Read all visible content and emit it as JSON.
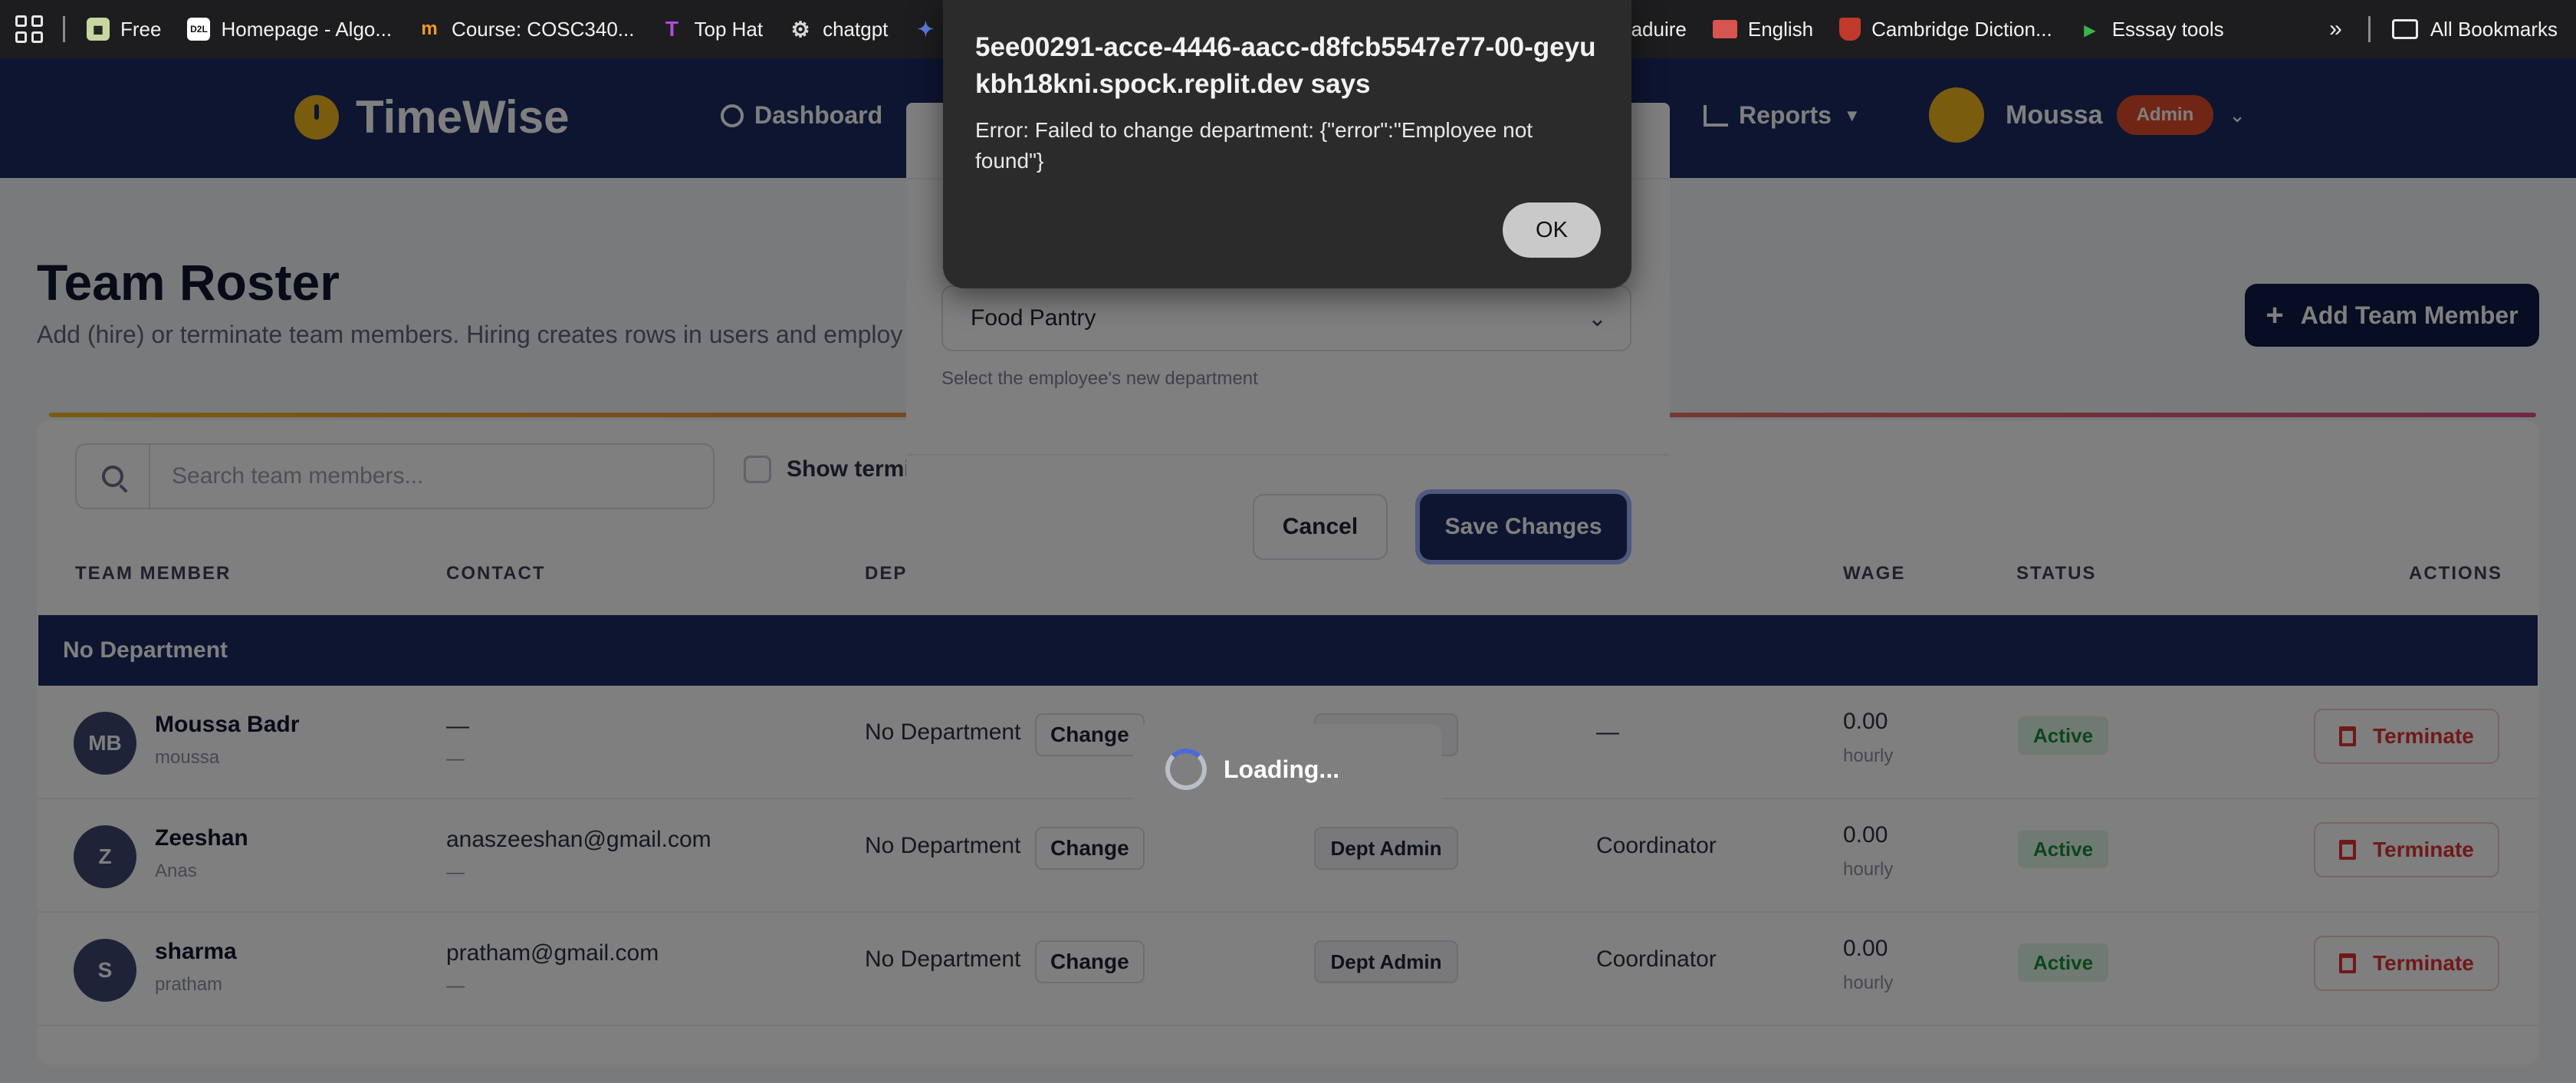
{
  "bookmarks": {
    "items": [
      {
        "label": "Free",
        "icon": "free-icon",
        "color": "#c8d6a0"
      },
      {
        "label": "Homepage - Algo...",
        "icon": "d2l-icon",
        "color": "#ffffff",
        "badge": "D2L"
      },
      {
        "label": "Course: COSC340...",
        "icon": "moodle-icon",
        "color": "#f59a23"
      },
      {
        "label": "Top Hat",
        "icon": "tophat-icon",
        "color": "#b148e0"
      },
      {
        "label": "chatgpt",
        "icon": "openai-icon",
        "color": "#d8d8d8"
      }
    ],
    "items_right": [
      {
        "label": "Traduire",
        "icon": "translate-icon",
        "color": "#4a86e8"
      },
      {
        "label": "English",
        "icon": "flag-icon",
        "color": "#d9534f"
      },
      {
        "label": "Cambridge Diction...",
        "icon": "cambridge-icon",
        "color": "#c0392b"
      },
      {
        "label": "Esssay tools",
        "icon": "essay-icon",
        "color": "#3bb34a"
      }
    ],
    "all_bookmarks": "All Bookmarks"
  },
  "app": {
    "name": "TimeWise",
    "nav": {
      "dashboard": "Dashboard",
      "reports": "Reports"
    },
    "user": {
      "name": "Moussa",
      "role": "Admin"
    }
  },
  "page": {
    "title": "Team Roster",
    "subtitle": "Add (hire) or terminate team members. Hiring creates rows in users and employees.",
    "add_button": "Add Team Member",
    "search_placeholder": "Search team members...",
    "show_terminated": "Show terminated"
  },
  "table": {
    "headers": {
      "member": "TEAM MEMBER",
      "contact": "CONTACT",
      "department": "DEPARTMENT",
      "wage": "WAGE",
      "status": "STATUS",
      "actions": "ACTIONS"
    },
    "group": "No Department",
    "change_label": "Change",
    "terminate_label": "Terminate",
    "rows": [
      {
        "initials": "MB",
        "name": "Moussa Badr",
        "username": "moussa",
        "contact": "—",
        "contact_sub": "—",
        "department": "No Department",
        "permission": "",
        "title": "—",
        "wage": "0.00",
        "wage_unit": "hourly",
        "status": "Active"
      },
      {
        "initials": "Z",
        "name": "Zeeshan",
        "username": "Anas",
        "contact": "anaszeeshan@gmail.com",
        "contact_sub": "—",
        "department": "No Department",
        "permission": "Dept Admin",
        "title": "Coordinator",
        "wage": "0.00",
        "wage_unit": "hourly",
        "status": "Active"
      },
      {
        "initials": "S",
        "name": "sharma",
        "username": "pratham",
        "contact": "pratham@gmail.com",
        "contact_sub": "—",
        "department": "No Department",
        "permission": "Dept Admin",
        "title": "Coordinator",
        "wage": "0.00",
        "wage_unit": "hourly",
        "status": "Active"
      }
    ]
  },
  "modal": {
    "selected_department": "Food Pantry",
    "help": "Select the employee's new department",
    "cancel": "Cancel",
    "save": "Save Changes"
  },
  "loading": {
    "text": "Loading..."
  },
  "alert": {
    "title": "5ee00291-acce-4446-aacc-d8fcb5547e77-00-geyukbh18kni.spock.replit.dev says",
    "message": "Error: Failed to change department: {\"error\":\"Employee not found\"}",
    "ok": "OK"
  },
  "colors": {
    "navy": "#1a2a63",
    "accent": "#f4b81e",
    "danger": "#e03232",
    "success": "#1b8a3a"
  }
}
